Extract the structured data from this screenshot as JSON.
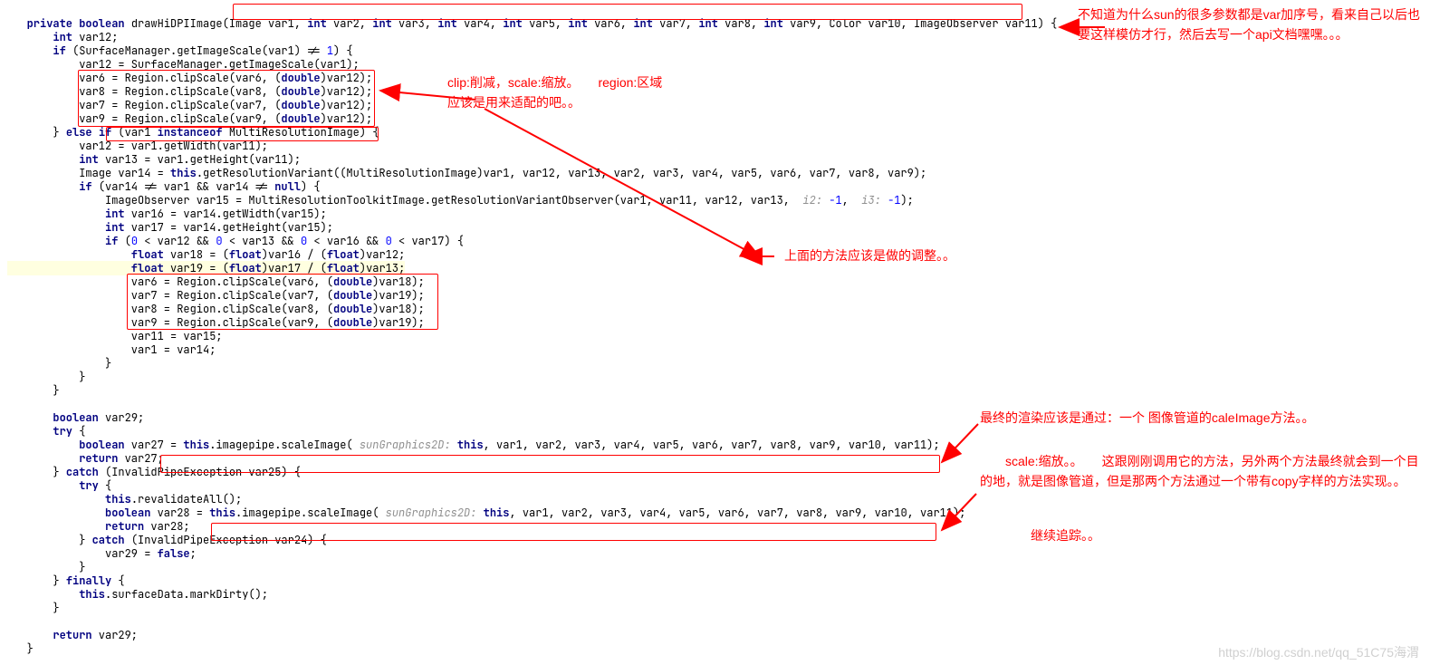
{
  "code": {
    "l1a": "   private boolean ",
    "l1b": "drawHiDPIImage",
    "l1c": "(Image var1, ",
    "l1d": "int",
    "l1e": " var2, ",
    "l1f": "int",
    "l1g": " var3, ",
    "l1h": "int",
    "l1i": " var4, ",
    "l1j": "int",
    "l1k": " var5, ",
    "l1l": "int",
    "l1m": " var6, ",
    "l1n": "int",
    "l1o": " var7, ",
    "l1p": "int",
    "l1q": " var8, ",
    "l1r": "int",
    "l1s": " var9, Color var10, ImageObserver var11) {",
    "l2a": "       int",
    "l2b": " var12;",
    "l3a": "       if",
    "l3b": " (SurfaceManager.getImageScale(var1) != ",
    "l3c": "1",
    "l3d": ") {",
    "l4": "           var12 = SurfaceManager.getImageScale(var1);",
    "l5a": "           var6 = Region.clipScale(var6, (",
    "l5b": "double",
    "l5c": ")var12);",
    "l6a": "           var8 = Region.clipScale(var8, (",
    "l6b": "double",
    "l6c": ")var12);",
    "l7a": "           var7 = Region.clipScale(var7, (",
    "l7b": "double",
    "l7c": ")var12);",
    "l8a": "           var9 = Region.clipScale(var9, (",
    "l8b": "double",
    "l8c": ")var12);",
    "l9a": "       } ",
    "l9b": "else if",
    "l9c": " (var1 ",
    "l9d": "instanceof",
    "l9e": " MultiResolutionImage) {",
    "l10": "           var12 = var1.getWidth(var11);",
    "l11a": "           int",
    "l11b": " var13 = var1.getHeight(var11);",
    "l12a": "           Image var14 = ",
    "l12b": "this",
    "l12c": ".getResolutionVariant((MultiResolutionImage)var1, var12, var13, var2, var3, var4, var5, var6, var7, var8, var9);",
    "l13a": "           if",
    "l13b": " (var14 != var1 && var14 != ",
    "l13c": "null",
    "l13d": ") {",
    "l14a": "               ImageObserver var15 = MultiResolutionToolkitImage.getResolutionVariantObserver(var1, var11, var12, var13, ",
    "l14b": " i2: ",
    "l14c": "-1",
    "l14d": ", ",
    "l14e": " i3: ",
    "l14f": "-1",
    "l14g": ");",
    "l15a": "               int",
    "l15b": " var16 = var14.getWidth(var15);",
    "l16a": "               int",
    "l16b": " var17 = var14.getHeight(var15);",
    "l17a": "               if",
    "l17b": " (",
    "l17c": "0",
    "l17d": " < var12 && ",
    "l17e": "0",
    "l17f": " < var13 && ",
    "l17g": "0",
    "l17h": " < var16 && ",
    "l17i": "0",
    "l17j": " < var17) {",
    "l18a": "                   float",
    "l18b": " var18 = (",
    "l18c": "float",
    "l18d": ")var16 / (",
    "l18e": "float",
    "l18f": ")var12;",
    "l19a": "                   float",
    "l19b": " var19 = (",
    "l19c": "float",
    "l19d": ")var17 / (",
    "l19e": "float",
    "l19f": ")var13;",
    "l20a": "                   var6 = Region.clipScale(var6, (",
    "l20b": "double",
    "l20c": ")var18);",
    "l21a": "                   var7 = Region.clipScale(var7, (",
    "l21b": "double",
    "l21c": ")var19);",
    "l22a": "                   var8 = Region.clipScale(var8, (",
    "l22b": "double",
    "l22c": ")var18);",
    "l23a": "                   var9 = Region.clipScale(var9, (",
    "l23b": "double",
    "l23c": ")var19);",
    "l24": "                   var11 = var15;",
    "l25": "                   var1 = var14;",
    "l26": "               }",
    "l27": "           }",
    "l28": "       }",
    "l29": "",
    "l30a": "       boolean",
    "l30b": " var29;",
    "l31a": "       try",
    "l31b": " {",
    "l32a": "           boolean",
    "l32b": " var27 = ",
    "l32c": "this",
    "l32d": ".imagepipe.scaleImage(",
    "l32e": " sunGraphics2D: ",
    "l32f": "this",
    "l32g": ", var1, var2, var3, var4, var5, var6, var7, var8, var9, var10, var11);",
    "l33a": "           return",
    "l33b": " var27;",
    "l34a": "       } ",
    "l34b": "catch",
    "l34c": " (InvalidPipeException var25) {",
    "l35a": "           try",
    "l35b": " {",
    "l36a": "               this",
    "l36b": ".revalidateAll();",
    "l37a": "               boolean",
    "l37b": " var28 = ",
    "l37c": "this",
    "l37d": ".imagepipe.scaleImage(",
    "l37e": " sunGraphics2D: ",
    "l37f": "this",
    "l37g": ", var1, var2, var3, var4, var5, var6, var7, var8, var9, var10, var11);",
    "l38a": "               return",
    "l38b": " var28;",
    "l39a": "           } ",
    "l39b": "catch",
    "l39c": " (InvalidPipeException var24) {",
    "l40a": "               var29 = ",
    "l40b": "false",
    "l40c": ";",
    "l41": "           }",
    "l42a": "       } ",
    "l42b": "finally",
    "l42c": " {",
    "l43a": "           this",
    "l43b": ".surfaceData.markDirty();",
    "l44": "       }",
    "l45": "",
    "l46a": "       return",
    "l46b": " var29;",
    "l47": "   }"
  },
  "notes": {
    "n1": "不知道为什么sun的很多参数都是var加序号，看来自己以后也要这样模仿才行，然后去写一个api文档嘿嘿。。。",
    "n2": "clip:削减，scale:缩放。　　region:区域\n应该是用来适配的吧。。",
    "n3": "上面的方法应该是做的调整。。",
    "n4a": "最终的渲染应该是通过：一个 图像管道的caleImage方法。。",
    "n4b": "　　scale:缩放。。　　这跟刚刚调用它的方法，另外两个方法最终就会到一个目的地，就是图像管道，但是那两个方法通过一个带有copy字样的方法实现。。",
    "n4c": "　　　　继续追踪。。"
  },
  "watermark": "https://blog.csdn.net/qq_51C75海渭"
}
